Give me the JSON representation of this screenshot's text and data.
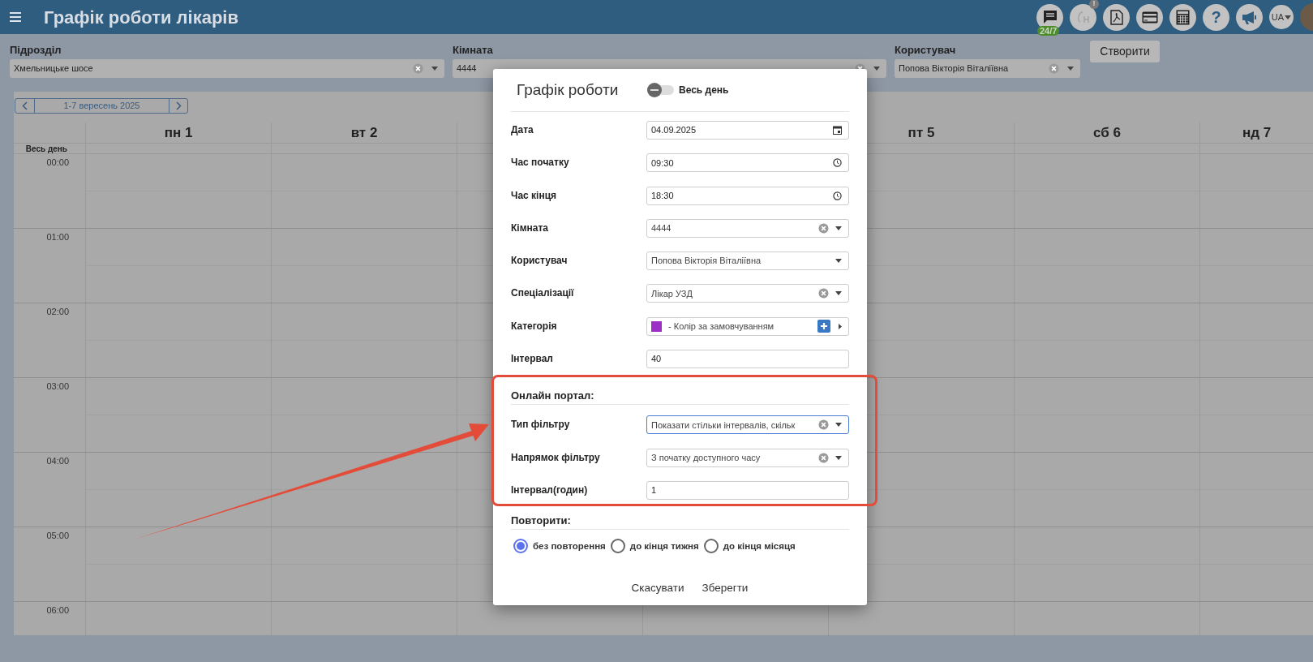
{
  "header": {
    "title": "Графік роботи лікарів",
    "chat_badge": "24/7",
    "logo_badge": "!",
    "help": "?",
    "language": "UA"
  },
  "filters": [
    {
      "label": "Підрозділ",
      "value": "Хмельницьке шосе",
      "clearable": true
    },
    {
      "label": "Кімната",
      "value": "4444",
      "clearable": true
    },
    {
      "label": "Користувач",
      "value": "Попова Вікторія Віталіївна",
      "clearable": true
    }
  ],
  "create_button": "Створити",
  "calendar": {
    "week_range": "1-7 вересень 2025",
    "days": [
      "пн 1",
      "вт 2",
      "пт 5",
      "сб 6",
      "нд 7"
    ],
    "all_day_label": "Весь день",
    "hours": [
      "00:00",
      "01:00",
      "02:00",
      "03:00",
      "04:00",
      "05:00",
      "06:00"
    ]
  },
  "modal": {
    "title": "Графік роботи",
    "all_day": {
      "label": "Весь день",
      "on": false
    },
    "fields": [
      {
        "label": "Дата",
        "kind": "date",
        "value": "04.09.2025",
        "focused": false
      },
      {
        "label": "Час початку",
        "kind": "time",
        "value": "09:30",
        "focused": false
      },
      {
        "label": "Час кінця",
        "kind": "time",
        "value": "18:30",
        "focused": false
      },
      {
        "label": "Кімната",
        "kind": "select",
        "value": "4444",
        "clearable": true,
        "focused": false
      },
      {
        "label": "Користувач",
        "kind": "select",
        "value": "Попова Вікторія Віталіївна",
        "clearable": false,
        "focused": false
      },
      {
        "label": "Спеціалізації",
        "kind": "select",
        "value": "Лікар УЗД",
        "clearable": true,
        "focused": false
      },
      {
        "label": "Категорія",
        "kind": "category",
        "value": "- Колір за замовчуванням",
        "color": "#9b2fc6",
        "focused": false
      },
      {
        "label": "Інтервал",
        "kind": "text",
        "value": "40",
        "focused": false
      }
    ],
    "online_portal": {
      "heading": "Онлайн портал:",
      "fields": [
        {
          "label": "Тип фільтру",
          "kind": "select",
          "value": "Показати стільки інтервалів, скільк",
          "clearable": true,
          "focused": true
        },
        {
          "label": "Напрямок фільтру",
          "kind": "select",
          "value": "З початку доступного часу",
          "clearable": true,
          "focused": false
        },
        {
          "label": "Інтервал(годин)",
          "kind": "text",
          "value": "1",
          "focused": false
        }
      ]
    },
    "repeat": {
      "heading": "Повторити:",
      "options": [
        {
          "label": "без повторення",
          "selected": true
        },
        {
          "label": "до кінця тижня",
          "selected": false
        },
        {
          "label": "до кінця місяця",
          "selected": false
        }
      ]
    },
    "buttons": [
      "Скасувати",
      "Зберегти"
    ]
  }
}
